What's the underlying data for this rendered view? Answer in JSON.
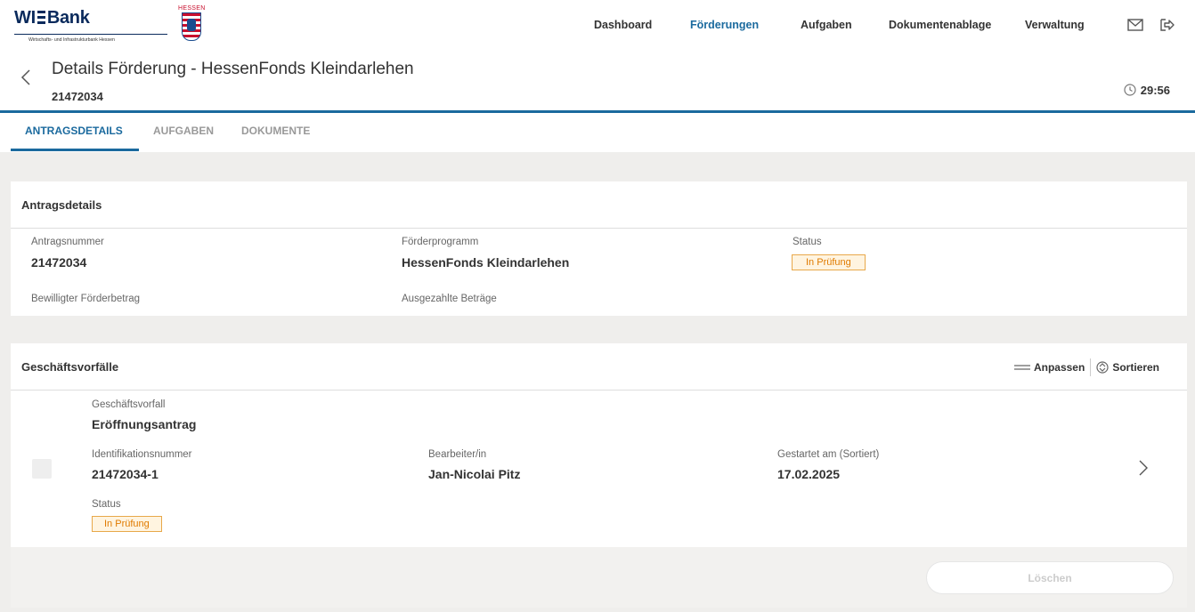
{
  "brand": {
    "logo_text": "WIBank",
    "logo_left": "WI",
    "logo_right": "Bank",
    "logo_subtitle": "Wirtschafts- und Infrastrukturbank Hessen",
    "crest_label": "HESSEN"
  },
  "nav": {
    "items": [
      {
        "label": "Dashboard"
      },
      {
        "label": "Förderungen"
      },
      {
        "label": "Aufgaben"
      },
      {
        "label": "Dokumentenablage"
      },
      {
        "label": "Verwaltung"
      }
    ],
    "active": "Förderungen"
  },
  "header_icons": [
    "mail-icon",
    "logout-icon"
  ],
  "page": {
    "title": "Details Förderung - HessenFonds Kleindarlehen",
    "id": "21472034",
    "timer": "29:56"
  },
  "tabs": [
    {
      "label": "ANTRAGSDETAILS"
    },
    {
      "label": "AUFGABEN"
    },
    {
      "label": "DOKUMENTE"
    }
  ],
  "antragsdetails": {
    "heading": "Antragsdetails",
    "antragsnummer_label": "Antragsnummer",
    "antragsnummer": "21472034",
    "foerderprogramm_label": "Förderprogramm",
    "foerderprogramm": "HessenFonds Kleindarlehen",
    "status_label": "Status",
    "status": "In Prüfung",
    "bewilligt_label": "Bewilligter Förderbetrag",
    "ausgezahlt_label": "Ausgezahlte Beträge"
  },
  "geschaeftsvorfaelle": {
    "heading": "Geschäftsvorfälle",
    "anpassen": "Anpassen",
    "sortieren": "Sortieren",
    "row": {
      "vorfall_label": "Geschäftsvorfall",
      "vorfall": "Eröffnungsantrag",
      "id_label": "Identifikationsnummer",
      "id": "21472034-1",
      "bearbeiter_label": "Bearbeiter/in",
      "bearbeiter": "Jan-Nicolai Pitz",
      "gestartet_label": "Gestartet am (Sortiert)",
      "gestartet": "17.02.2025",
      "status_label": "Status",
      "status": "In Prüfung"
    },
    "delete_label": "Löschen"
  },
  "colors": {
    "accent": "#1b6a9e",
    "status_orange": "#e07b00",
    "background": "#efeeec"
  }
}
